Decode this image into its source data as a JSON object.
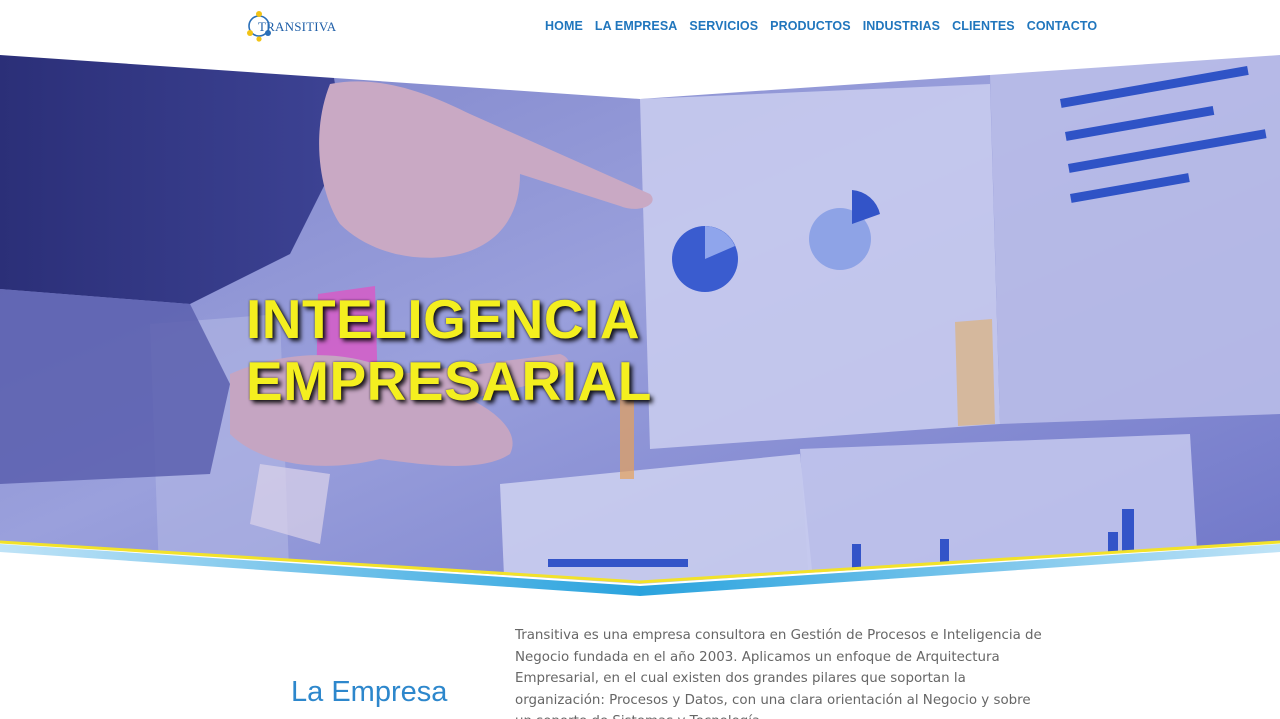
{
  "brand": {
    "logo_text": "TRANSITIVA"
  },
  "nav": {
    "items": [
      {
        "label": "HOME"
      },
      {
        "label": "LA EMPRESA"
      },
      {
        "label": "SERVICIOS"
      },
      {
        "label": "PRODUCTOS"
      },
      {
        "label": "INDUSTRIAS"
      },
      {
        "label": "CLIENTES"
      },
      {
        "label": "CONTACTO"
      }
    ]
  },
  "hero": {
    "title_line1": "INTELIGENCIA",
    "title_line2": "EMPRESARIAL",
    "overlay_color": "#3a3fb8",
    "title_color": "#f4ef1f"
  },
  "about": {
    "heading": "La Empresa",
    "text": "Transitiva es una empresa consultora en Gestión de Procesos e Inteligencia de Negocio fundada en el año 2003. Aplicamos un enfoque de Arquitectura Empresarial, en el cual existen dos grandes pilares que soportan la organización: Procesos y Datos, con una clara orientación al Negocio y sobre un soporte de Sistemas y Tecnología."
  },
  "colors": {
    "accent": "#2076bd",
    "heading_blue": "#2d87cc",
    "wave_yellow": "#f2e22a",
    "wave_blue": "#2aa3de"
  }
}
